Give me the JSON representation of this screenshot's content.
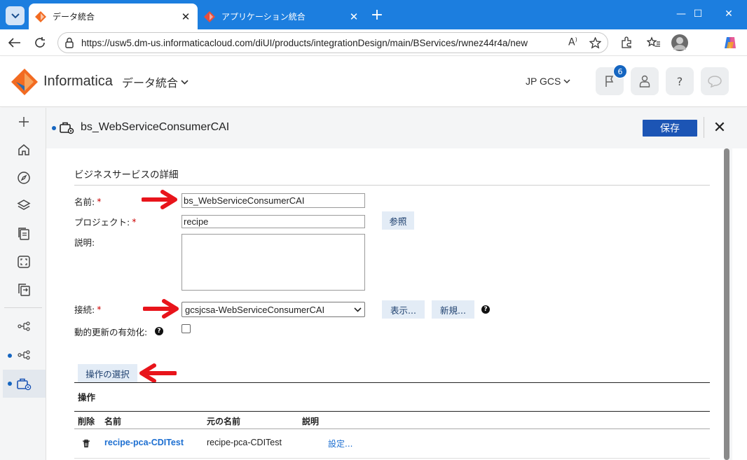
{
  "browser": {
    "tabs": [
      {
        "title": "データ統合",
        "close": "✕",
        "active": true
      },
      {
        "title": "アプリケーション統合",
        "close": "✕",
        "active": false
      }
    ],
    "new_tab": "+",
    "url": "https://usw5.dm-us.informaticacloud.com/diUI/products/integrationDesign/main/BServices/rwnez44r4a/new",
    "window_controls": [
      "—",
      "☐",
      "✕"
    ]
  },
  "app": {
    "brand": "Informatica",
    "product": "データ統合",
    "org": "JP GCS",
    "notification_count": "6",
    "help": "?"
  },
  "object": {
    "title": "bs_WebServiceConsumerCAI",
    "save_label": "保存",
    "close": "✕"
  },
  "form": {
    "section_title": "ビジネスサービスの詳細",
    "required_mark": "*",
    "name_label": "名前:",
    "name_value": "bs_WebServiceConsumerCAI",
    "project_label": "プロジェクト:",
    "project_value": "recipe",
    "browse_label": "参照",
    "description_label": "説明:",
    "description_value": "",
    "connection_label": "接続:",
    "connection_value": "gcsjcsa-WebServiceConsumerCAI",
    "show_label": "表示...",
    "new_label": "新規...",
    "dynamic_label": "動的更新の有効化:",
    "dynamic_checked": false
  },
  "operations": {
    "select_button": "操作の選択",
    "heading": "操作",
    "columns": [
      "削除",
      "名前",
      "元の名前",
      "説明"
    ],
    "rows": [
      {
        "name": "recipe-pca-CDITest",
        "original_name": "recipe-pca-CDITest",
        "settings": "設定..."
      }
    ]
  },
  "accent_color": "#1c55b5"
}
